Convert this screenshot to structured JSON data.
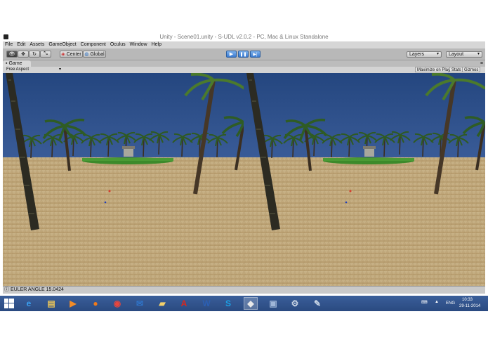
{
  "window": {
    "title": "Unity - Scene01.unity - S-UDL v2.0.2 - PC, Mac & Linux Standalone"
  },
  "menu": {
    "items": [
      "File",
      "Edit",
      "Assets",
      "GameObject",
      "Component",
      "Oculus",
      "Window",
      "Help"
    ]
  },
  "toolbar": {
    "tools": [
      {
        "icon": "eye-icon",
        "glyph": "👁"
      },
      {
        "icon": "move-icon",
        "glyph": "✥"
      },
      {
        "icon": "rotate-icon",
        "glyph": "↻"
      },
      {
        "icon": "scale-icon",
        "glyph": "⤡"
      }
    ],
    "pivot_label": "Center",
    "space_label": "Global",
    "play_glyph": "▶",
    "pause_glyph": "❚❚",
    "step_glyph": "▶|",
    "layers_label": "Layers",
    "layout_label": "Layout"
  },
  "game_view": {
    "tab_label": "Game",
    "aspect_label": "Free Aspect",
    "maximize_label": "Maximize on Play",
    "stats_label": "Stats",
    "gizmos_label": "Gizmos"
  },
  "status": {
    "text": "EULER ANGLE 15.0424"
  },
  "taskbar": {
    "apps": [
      {
        "name": "ie-icon",
        "glyph": "e",
        "color": "#3aa0f0"
      },
      {
        "name": "explorer-icon",
        "glyph": "▤",
        "color": "#e6c25a"
      },
      {
        "name": "media-player-icon",
        "glyph": "▶",
        "color": "#f28c28"
      },
      {
        "name": "firefox-icon",
        "glyph": "●",
        "color": "#f07a1a"
      },
      {
        "name": "chrome-icon",
        "glyph": "◉",
        "color": "#e8453c"
      },
      {
        "name": "mail-icon",
        "glyph": "✉",
        "color": "#2f74c9"
      },
      {
        "name": "folder-icon",
        "glyph": "▰",
        "color": "#f3d06b"
      },
      {
        "name": "acrobat-icon",
        "glyph": "A",
        "color": "#d9261c"
      },
      {
        "name": "word-icon",
        "glyph": "W",
        "color": "#2b5fb3"
      },
      {
        "name": "skype-icon",
        "glyph": "S",
        "color": "#1ba1e6"
      },
      {
        "name": "unity-icon",
        "glyph": "◆",
        "color": "#e9e9e9"
      },
      {
        "name": "monitor-icon",
        "glyph": "▣",
        "color": "#9fb6d8"
      },
      {
        "name": "settings-icon",
        "glyph": "⚙",
        "color": "#c7d3e3"
      },
      {
        "name": "tools-icon",
        "glyph": "✎",
        "color": "#c9d6e6"
      }
    ],
    "active_app_index": 10,
    "language": "ENG",
    "time": "10:33",
    "date": "29-11-2014"
  }
}
